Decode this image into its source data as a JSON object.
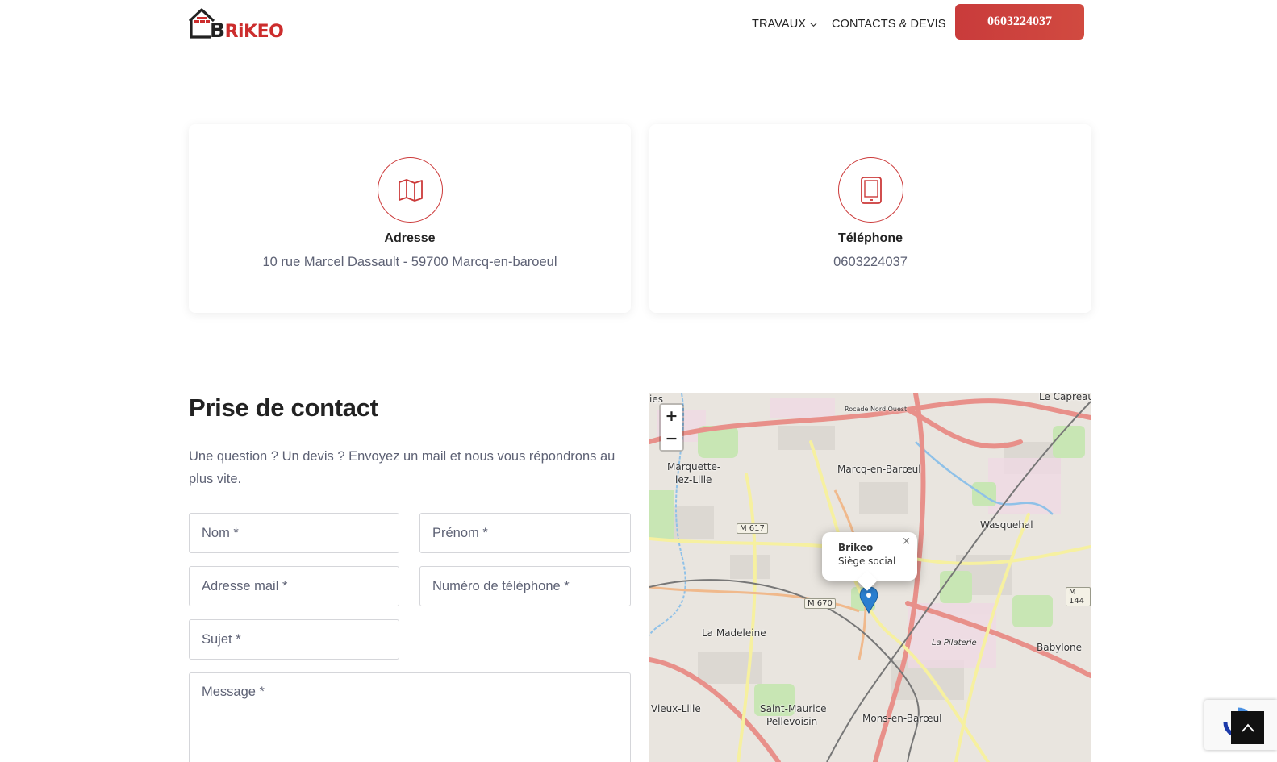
{
  "header": {
    "logo_text_b": "B",
    "logo_text_rest": "RiKEO",
    "nav": [
      {
        "label": "TRAVAUX"
      },
      {
        "label": "CONTACTS & DEVIS"
      }
    ],
    "phone_button": "0603224037"
  },
  "cards": {
    "address": {
      "icon": "map-icon",
      "title": "Adresse",
      "text": "10 rue Marcel Dassault - 59700 Marcq-en-baroeul"
    },
    "phone": {
      "icon": "tablet-icon",
      "title": "Téléphone",
      "text": "0603224037"
    }
  },
  "contact": {
    "title": "Prise de contact",
    "description": "Une question ? Un devis ? Envoyez un mail et nous vous répondrons au plus vite.",
    "fields": {
      "nom": "Nom *",
      "prenom": "Prénom *",
      "email": "Adresse mail *",
      "telephone": "Numéro de téléphone *",
      "sujet": "Sujet *",
      "message": "Message *"
    }
  },
  "map": {
    "zoom_in": "+",
    "zoom_out": "−",
    "popup": {
      "title": "Brikeo",
      "subtitle": "Siège social",
      "close": "×"
    },
    "places": {
      "marquette": "Marquette-",
      "marquette2": "lez-Lille",
      "marcq": "Marcq-en-Barœul",
      "wasquehal": "Wasquehal",
      "madeleine": "La Madeleine",
      "babylone": "Babylone",
      "vieuxlille": "Vieux-Lille",
      "stmaurice": "Saint-Maurice",
      "pellevoisin": "Pellevoisin",
      "mons": "Mons-en-Barœul",
      "capreau": "Le Capreau",
      "pilaterie": "La Pilaterie",
      "ies": "ies",
      "rocade": "Rocade Nord Ouest"
    },
    "roads": {
      "m617": "M 617",
      "m670": "M 670",
      "m144": "M 144"
    },
    "colors": {
      "primary_road": "#e8908a",
      "secondary_road": "#f6f0a0",
      "park": "#c8e6b4",
      "water": "#8fc1e8"
    }
  },
  "colors": {
    "accent": "#cc3a3a",
    "text_muted": "#5e6275"
  }
}
